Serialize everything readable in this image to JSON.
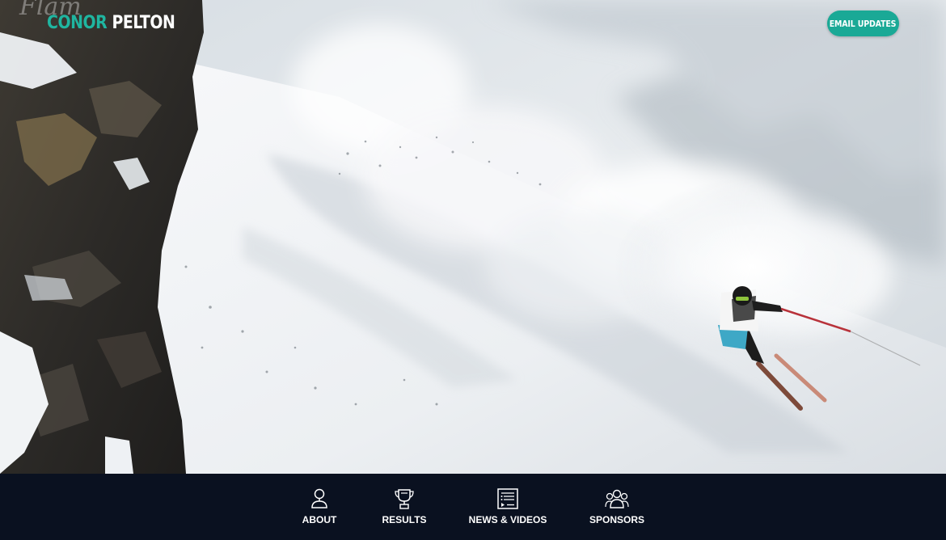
{
  "header": {
    "logo_first": "CONOR",
    "logo_last": "PELTON",
    "email_button": "EMAIL UPDATES"
  },
  "hero": {
    "image_subject": "skier-in-powder-snow"
  },
  "nav": {
    "items": [
      {
        "label": "ABOUT",
        "icon": "person-pin-icon"
      },
      {
        "label": "RESULTS",
        "icon": "trophy-icon"
      },
      {
        "label": "NEWS & VIDEOS",
        "icon": "news-video-icon"
      },
      {
        "label": "SPONSORS",
        "icon": "group-icon"
      }
    ]
  },
  "colors": {
    "accent": "#1aa996",
    "nav_background": "#0a1120",
    "nav_text": "#ffffff"
  }
}
